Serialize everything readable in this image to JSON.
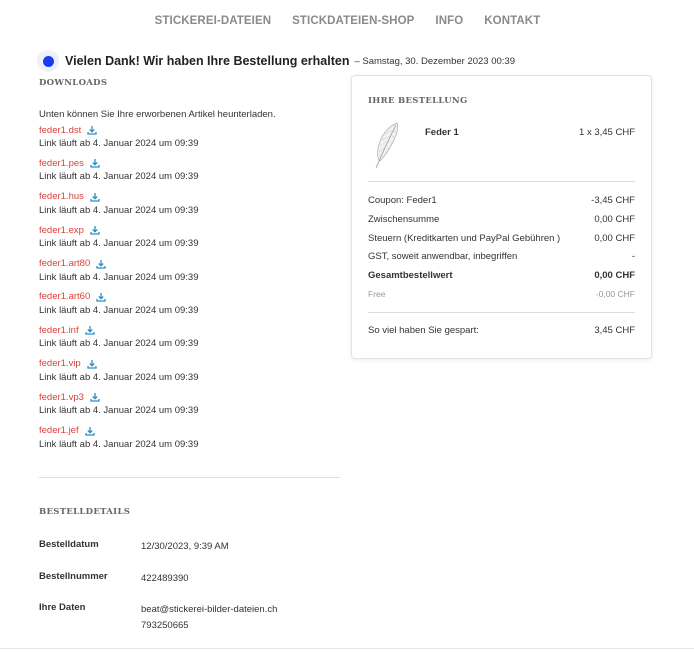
{
  "nav": {
    "items": [
      "STICKEREI-DATEIEN",
      "STICKDATEIEN-SHOP",
      "INFO",
      "KONTAKT"
    ]
  },
  "header": {
    "title": "Vielen Dank! Wir haben Ihre Bestellung erhalten",
    "date": "– Samstag, 30. Dezember 2023 00:39"
  },
  "downloads": {
    "heading": "DOWNLOADS",
    "intro": "Unten können Sie Ihre erworbenen Artikel heunterladen.",
    "items": [
      {
        "file": "feder1.dst",
        "expiry": "Link läuft ab 4. Januar 2024 um 09:39"
      },
      {
        "file": "feder1.pes",
        "expiry": "Link läuft ab 4. Januar 2024 um 09:39"
      },
      {
        "file": "feder1.hus",
        "expiry": "Link läuft ab 4. Januar 2024 um 09:39"
      },
      {
        "file": "feder1.exp",
        "expiry": "Link läuft ab 4. Januar 2024 um 09:39"
      },
      {
        "file": "feder1.art80",
        "expiry": "Link läuft ab 4. Januar 2024 um 09:39"
      },
      {
        "file": "feder1.art60",
        "expiry": "Link läuft ab 4. Januar 2024 um 09:39"
      },
      {
        "file": "feder1.inf",
        "expiry": "Link läuft ab 4. Januar 2024 um 09:39"
      },
      {
        "file": "feder1.vip",
        "expiry": "Link läuft ab 4. Januar 2024 um 09:39"
      },
      {
        "file": "feder1.vp3",
        "expiry": "Link läuft ab 4. Januar 2024 um 09:39"
      },
      {
        "file": "feder1.jef",
        "expiry": "Link läuft ab 4. Januar 2024 um 09:39"
      }
    ]
  },
  "details": {
    "heading": "BESTELLDETAILS",
    "date_label": "Bestelldatum",
    "date_value": "12/30/2023, 9:39 AM",
    "number_label": "Bestellnummer",
    "number_value": "422489390",
    "contact_label": "Ihre Daten",
    "email": "beat@stickerei-bilder-dateien.ch",
    "phone": "793250665"
  },
  "order": {
    "heading": "IHRE BESTELLUNG",
    "product_name": "Feder 1",
    "product_qty": "1 x 3,45 CHF",
    "coupon_label": "Coupon: Feder1",
    "coupon_value": "-3,45 CHF",
    "subtotal_label": "Zwischensumme",
    "subtotal_value": "0,00 CHF",
    "tax_label": "Steuern (Kreditkarten und PayPal Gebühren )",
    "tax_value": "0,00 CHF",
    "gst_label": "GST, soweit anwendbar, inbegriffen",
    "gst_value": "-",
    "total_label": "Gesamtbestellwert",
    "total_value": "0,00 CHF",
    "free_label": "Free",
    "free_value": "-0,00 CHF",
    "saved_label": "So viel haben Sie gespart:",
    "saved_value": "3,45 CHF"
  },
  "colors": {
    "link": "#d9413b",
    "download_icon": "#2a8fc7",
    "status_dot": "#1a3bf0"
  },
  "icons": {
    "download": "download-icon",
    "product": "feather-icon",
    "status": "status-dot-icon"
  }
}
